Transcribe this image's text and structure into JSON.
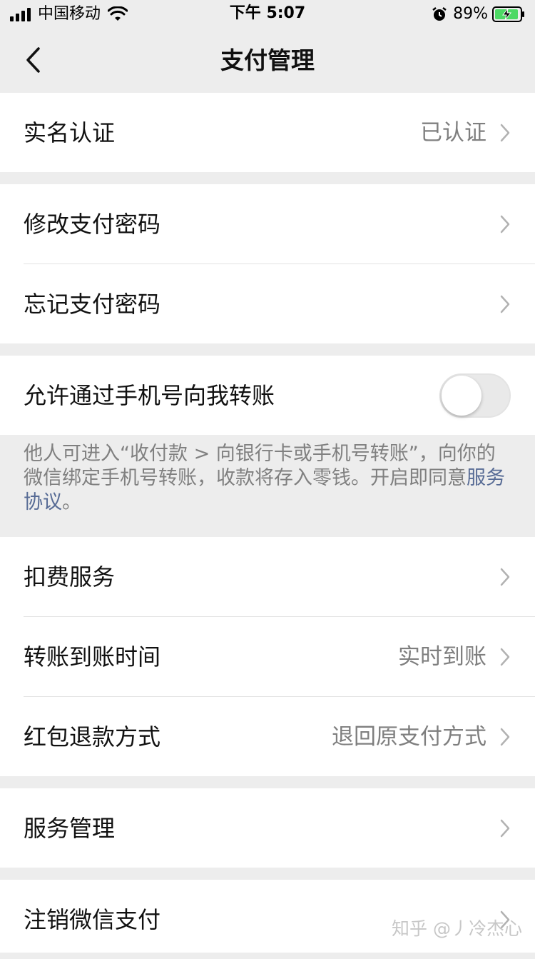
{
  "status_bar": {
    "carrier": "中国移动",
    "time": "下午 5:07",
    "battery": "89%",
    "icons": [
      "signal-icon",
      "wifi-icon",
      "alarm-icon",
      "battery-charging-icon"
    ]
  },
  "nav": {
    "title": "支付管理",
    "back_icon": "chevron-left-icon"
  },
  "rows": {
    "real_name": {
      "label": "实名认证",
      "value": "已认证"
    },
    "change_password": {
      "label": "修改支付密码"
    },
    "forgot_password": {
      "label": "忘记支付密码"
    },
    "phone_transfer": {
      "label": "允许通过手机号向我转账",
      "enabled": false
    },
    "deduction_service": {
      "label": "扣费服务"
    },
    "transfer_time": {
      "label": "转账到账时间",
      "value": "实时到账"
    },
    "red_packet_refund": {
      "label": "红包退款方式",
      "value": "退回原支付方式"
    },
    "service_management": {
      "label": "服务管理"
    },
    "cancel_wechat_pay": {
      "label": "注销微信支付"
    }
  },
  "note": {
    "text": "他人可进入“收付款 > 向银行卡或手机号转账”，向你的微信绑定手机号转账，收款将存入零钱。开启即同意",
    "link": "服务协议",
    "suffix": "。"
  },
  "watermark": "知乎 @丿冷杰心",
  "colors": {
    "background": "#ededed",
    "card": "#ffffff",
    "link": "#576b95",
    "secondary_text": "#7f7f7f"
  }
}
